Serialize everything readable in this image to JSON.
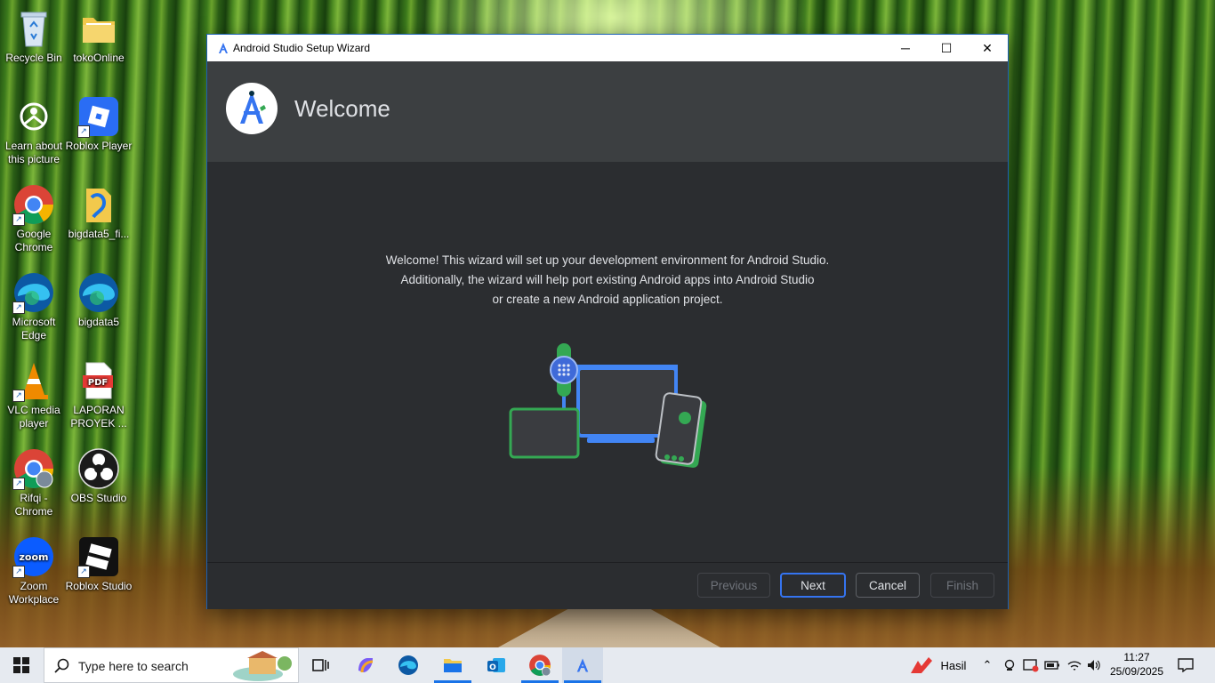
{
  "desktop": {
    "icons": [
      {
        "label": "Recycle Bin"
      },
      {
        "label": "tokoOnline"
      },
      {
        "label": "Learn about this picture"
      },
      {
        "label": "Roblox Player"
      },
      {
        "label": "Google Chrome"
      },
      {
        "label": "bigdata5_fi..."
      },
      {
        "label": "Microsoft Edge"
      },
      {
        "label": "bigdata5"
      },
      {
        "label": "VLC media player"
      },
      {
        "label": "LAPORAN PROYEK ..."
      },
      {
        "label": "Rifqi - Chrome"
      },
      {
        "label": "OBS Studio"
      },
      {
        "label": "Zoom Workplace"
      },
      {
        "label": "Roblox Studio"
      }
    ]
  },
  "window": {
    "title": "Android Studio Setup Wizard",
    "controls": {
      "minimize": "─",
      "maximize": "☐",
      "close": "✕"
    },
    "header_title": "Welcome",
    "description": [
      "Welcome! This wizard will set up your development environment for Android Studio.",
      "Additionally, the wizard will help port existing Android apps into Android Studio",
      "or create a new Android application project."
    ],
    "buttons": {
      "previous": "Previous",
      "next": "Next",
      "cancel": "Cancel",
      "finish": "Finish"
    }
  },
  "taskbar": {
    "search_placeholder": "Type here to search",
    "tray_app_label": "Hasil",
    "time": "11:27",
    "date": "25/09/2025"
  },
  "icons": {
    "start": "windows-logo-icon",
    "search": "search-icon",
    "task_view": "task-view-icon"
  },
  "colors": {
    "accent": "#3574f0",
    "window_bg": "#2b2d30",
    "header_bg": "#3c3f41",
    "green": "#34a853",
    "blue": "#4285f4"
  }
}
